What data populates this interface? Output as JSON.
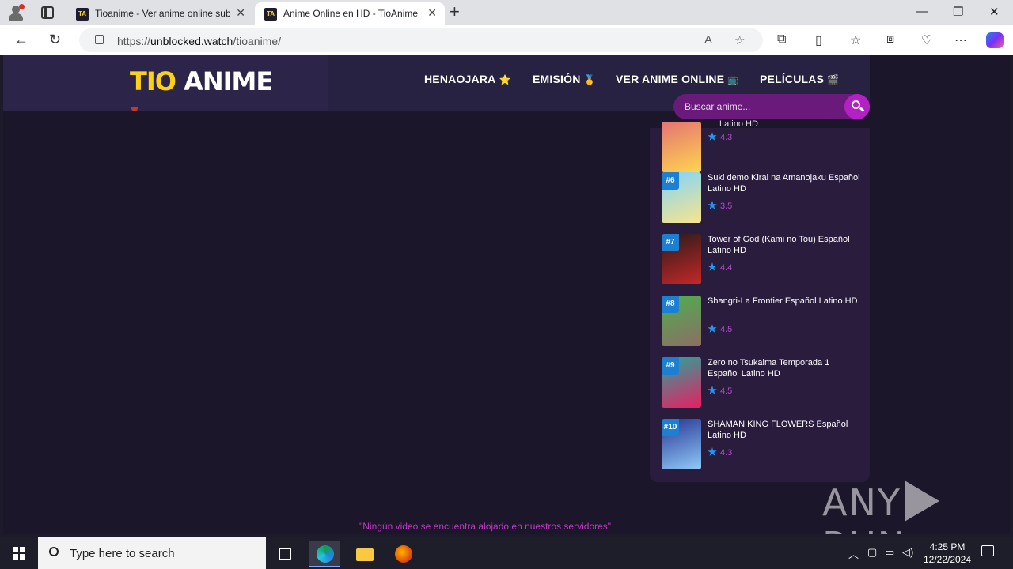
{
  "browser": {
    "tabs": [
      {
        "title": "Tioanime - Ver anime online sub",
        "active": false
      },
      {
        "title": "Anime Online en HD - TioAnime",
        "active": true
      }
    ],
    "url_prefix": "https://",
    "url_host": "unblocked.watch",
    "url_path": "/tioanime/"
  },
  "site": {
    "logo_part1": "TIO",
    "logo_part2": " ANIME",
    "nav": [
      {
        "label": "HENAOJARA",
        "emoji": "⭐"
      },
      {
        "label": "EMISIÓN",
        "emoji": "🥇"
      },
      {
        "label": "VER ANIME ONLINE",
        "emoji": "📺"
      },
      {
        "label": "PELÍCULAS",
        "emoji": "🎬"
      }
    ],
    "search_placeholder": "Buscar anime...",
    "partial_title": "Latino HD",
    "ranking": [
      {
        "rank": "",
        "title": "",
        "rating": "4.3",
        "colors": [
          "#e57373",
          "#ffd54f"
        ]
      },
      {
        "rank": "#6",
        "title": "Suki demo Kirai na Amanojaku Español Latino HD",
        "rating": "3.5",
        "colors": [
          "#81d4fa",
          "#f8e58c"
        ]
      },
      {
        "rank": "#7",
        "title": "Tower of God (Kami no Tou) Español Latino HD",
        "rating": "4.4",
        "colors": [
          "#2b1a1a",
          "#c62828"
        ]
      },
      {
        "rank": "#8",
        "title": "Shangri-La Frontier Español Latino HD",
        "rating": "4.5",
        "colors": [
          "#4caf50",
          "#8d6e63"
        ]
      },
      {
        "rank": "#9",
        "title": "Zero no Tsukaima Temporada 1 Español Latino HD",
        "rating": "4.5",
        "colors": [
          "#26a69a",
          "#e91e63"
        ]
      },
      {
        "rank": "#10",
        "title": "SHAMAN KING FLOWERS Español Latino HD",
        "rating": "4.3",
        "colors": [
          "#283593",
          "#90caf9"
        ]
      }
    ],
    "footer_note": "\"Ningún video se encuentra alojado en nuestros servidores\"",
    "watermark_left": "ANY",
    "watermark_right": "RUN"
  },
  "taskbar": {
    "search_text": "Type here to search",
    "time": "4:25 PM",
    "date": "12/22/2024"
  }
}
